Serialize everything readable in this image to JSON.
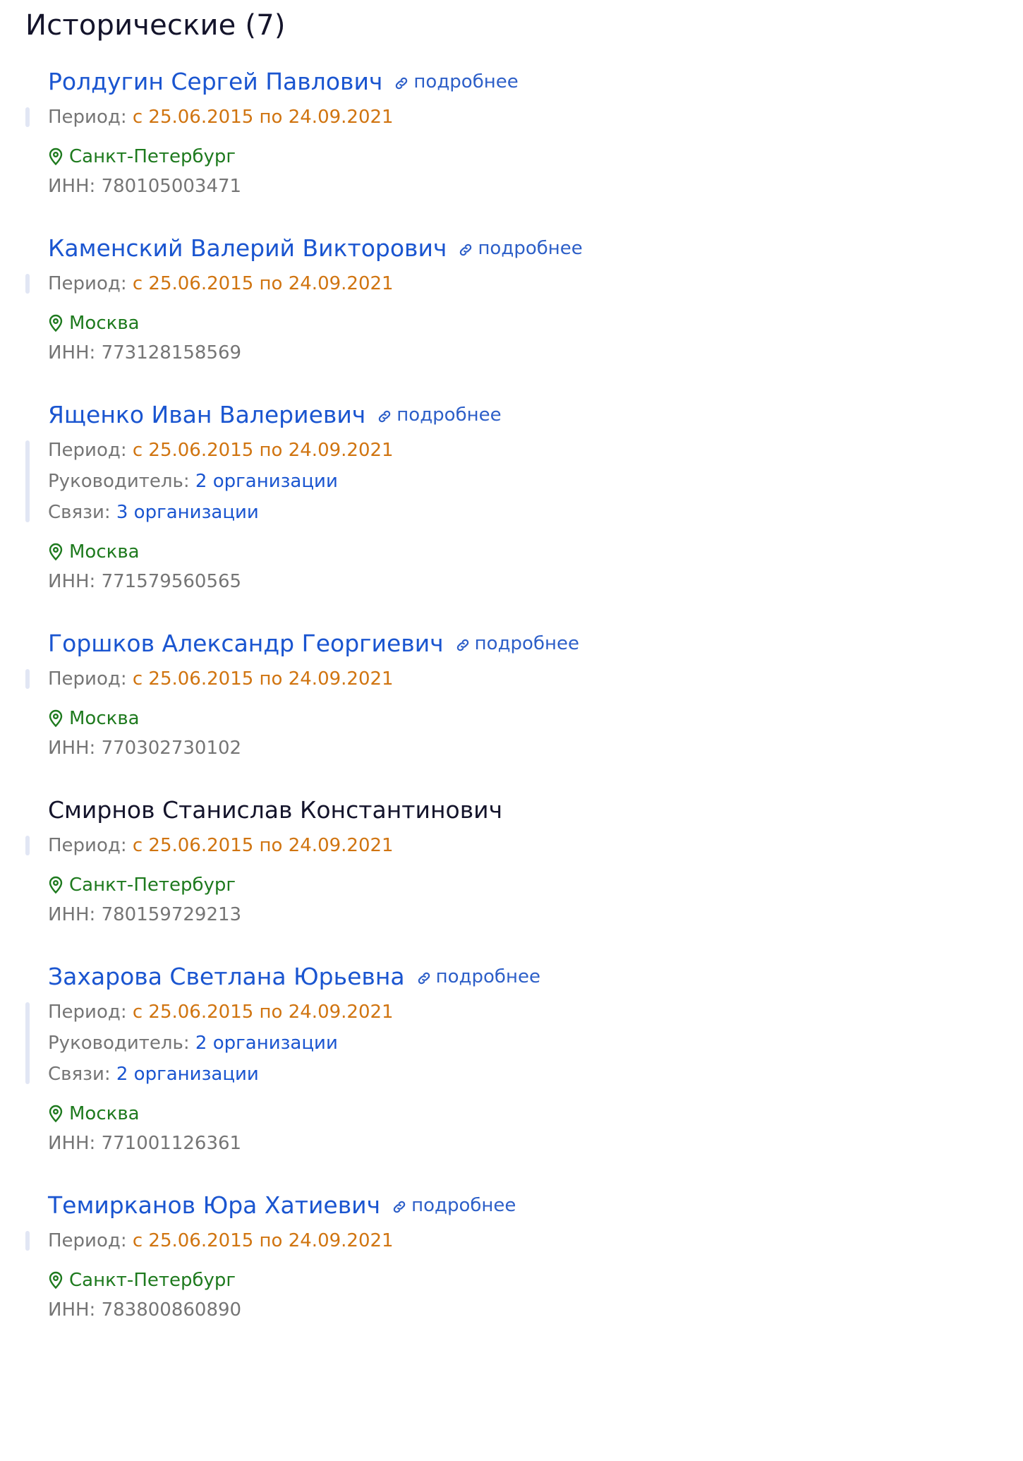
{
  "section": {
    "title": "Исторические (7)"
  },
  "more_label": "подробнее",
  "labels": {
    "period": "Период:",
    "head": "Руководитель:",
    "links": "Связи:",
    "inn": "ИНН:"
  },
  "persons": [
    {
      "name": "Ролдугин Сергей Павлович",
      "has_more": true,
      "period": "с 25.06.2015 по 24.09.2021",
      "city": "Санкт-Петербург",
      "inn": "780105003471"
    },
    {
      "name": "Каменский Валерий Викторович",
      "has_more": true,
      "period": "с 25.06.2015 по 24.09.2021",
      "city": "Москва",
      "inn": "773128158569"
    },
    {
      "name": "Ященко Иван Валериевич",
      "has_more": true,
      "period": "с 25.06.2015 по 24.09.2021",
      "head": "2 организации",
      "links": "3 организации",
      "city": "Москва",
      "inn": "771579560565"
    },
    {
      "name": "Горшков Александр Георгиевич",
      "has_more": true,
      "period": "с 25.06.2015 по 24.09.2021",
      "city": "Москва",
      "inn": "770302730102"
    },
    {
      "name": "Смирнов Станислав Константинович",
      "has_more": false,
      "period": "с 25.06.2015 по 24.09.2021",
      "city": "Санкт-Петербург",
      "inn": "780159729213"
    },
    {
      "name": "Захарова Светлана Юрьевна",
      "has_more": true,
      "period": "с 25.06.2015 по 24.09.2021",
      "head": "2 организации",
      "links": "2 организации",
      "city": "Москва",
      "inn": "771001126361"
    },
    {
      "name": "Темирканов Юра Хатиевич",
      "has_more": true,
      "period": "с 25.06.2015 по 24.09.2021",
      "city": "Санкт-Петербург",
      "inn": "783800860890"
    }
  ]
}
